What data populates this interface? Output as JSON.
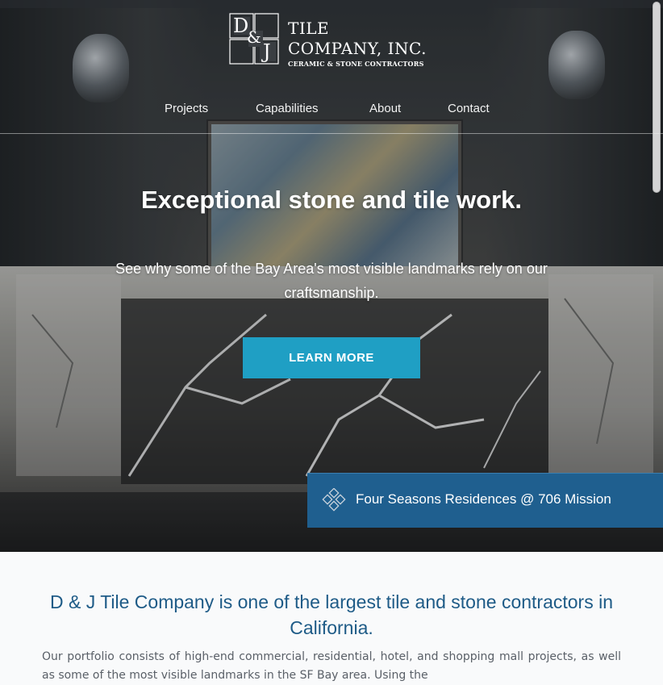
{
  "brand": {
    "mark_letters": [
      "D",
      "&",
      "J"
    ],
    "name_line1": "TILE",
    "name_line2": "COMPANY, INC.",
    "tagline": "CERAMIC & STONE CONTRACTORS"
  },
  "nav": {
    "items": [
      {
        "label": "Projects"
      },
      {
        "label": "Capabilities"
      },
      {
        "label": "About"
      },
      {
        "label": "Contact"
      }
    ]
  },
  "hero": {
    "title": "Exceptional stone and tile work.",
    "subtitle": "See why some of the Bay Area's most visible landmarks rely on our craftsmanship.",
    "cta_label": "LEARN MORE",
    "caption": "Four Seasons Residences @ 706 Mission",
    "caption_icon": "diamond-tiles-icon"
  },
  "intro": {
    "title": "D & J Tile Company is one of the largest tile and stone contractors in California.",
    "body": "Our portfolio consists of high-end commercial, residential, hotel, and shopping mall projects, as well as some of the most visible landmarks in the SF Bay area. Using the"
  },
  "colors": {
    "accent": "#1f9fc4",
    "caption_bg": "#1f5f8f",
    "intro_title": "#1e5b87"
  }
}
